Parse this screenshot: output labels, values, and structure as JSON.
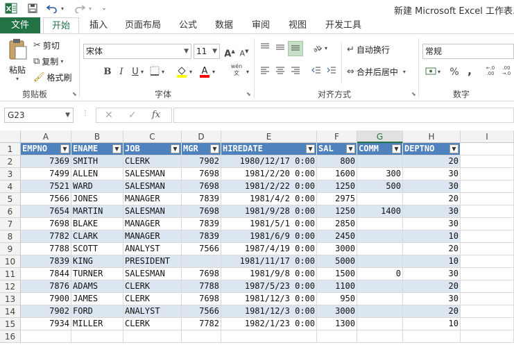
{
  "titlebar": {
    "title": "新建 Microsoft Excel 工作表.xlsx"
  },
  "tabs": [
    "文件",
    "开始",
    "插入",
    "页面布局",
    "公式",
    "数据",
    "审阅",
    "视图",
    "开发工具"
  ],
  "ribbon": {
    "clipboard": {
      "paste": "粘贴",
      "cut": "剪切",
      "copy": "复制",
      "format_painter": "格式刷",
      "label": "剪贴板"
    },
    "font": {
      "name": "宋体",
      "size": "11",
      "bold": "B",
      "italic": "I",
      "underline": "U",
      "label": "字体",
      "phonetic": "wén"
    },
    "alignment": {
      "wrap": "自动换行",
      "merge": "合并后居中",
      "label": "对齐方式"
    },
    "number": {
      "format": "常规",
      "label": "数字",
      "percent": "%",
      "comma": ","
    }
  },
  "formula_bar": {
    "name_box": "G23",
    "formula": ""
  },
  "columns": [
    "A",
    "B",
    "C",
    "D",
    "E",
    "F",
    "G",
    "H",
    "I"
  ],
  "selected_column": "G",
  "header": [
    "EMPNO",
    "ENAME",
    "JOB",
    "MGR",
    "HIREDATE",
    "SAL",
    "COMM",
    "DEPTNO"
  ],
  "rows": [
    [
      "7369",
      "SMITH",
      "CLERK",
      "7902",
      "1980/12/17  0:00",
      "800",
      "",
      "20"
    ],
    [
      "7499",
      "ALLEN",
      "SALESMAN",
      "7698",
      "1981/2/20  0:00",
      "1600",
      "300",
      "30"
    ],
    [
      "7521",
      "WARD",
      "SALESMAN",
      "7698",
      "1981/2/22  0:00",
      "1250",
      "500",
      "30"
    ],
    [
      "7566",
      "JONES",
      "MANAGER",
      "7839",
      "1981/4/2  0:00",
      "2975",
      "",
      "20"
    ],
    [
      "7654",
      "MARTIN",
      "SALESMAN",
      "7698",
      "1981/9/28  0:00",
      "1250",
      "1400",
      "30"
    ],
    [
      "7698",
      "BLAKE",
      "MANAGER",
      "7839",
      "1981/5/1  0:00",
      "2850",
      "",
      "30"
    ],
    [
      "7782",
      "CLARK",
      "MANAGER",
      "7839",
      "1981/6/9  0:00",
      "2450",
      "",
      "10"
    ],
    [
      "7788",
      "SCOTT",
      "ANALYST",
      "7566",
      "1987/4/19  0:00",
      "3000",
      "",
      "20"
    ],
    [
      "7839",
      "KING",
      "PRESIDENT",
      "",
      "1981/11/17  0:00",
      "5000",
      "",
      "10"
    ],
    [
      "7844",
      "TURNER",
      "SALESMAN",
      "7698",
      "1981/9/8  0:00",
      "1500",
      "0",
      "30"
    ],
    [
      "7876",
      "ADAMS",
      "CLERK",
      "7788",
      "1987/5/23  0:00",
      "1100",
      "",
      "20"
    ],
    [
      "7900",
      "JAMES",
      "CLERK",
      "7698",
      "1981/12/3  0:00",
      "950",
      "",
      "30"
    ],
    [
      "7902",
      "FORD",
      "ANALYST",
      "7566",
      "1981/12/3  0:00",
      "3000",
      "",
      "20"
    ],
    [
      "7934",
      "MILLER",
      "CLERK",
      "7782",
      "1982/1/23  0:00",
      "1300",
      "",
      "10"
    ]
  ],
  "row_numbers": [
    "1",
    "2",
    "3",
    "4",
    "5",
    "6",
    "7",
    "8",
    "9",
    "10",
    "11",
    "12",
    "13",
    "14",
    "15",
    "16"
  ],
  "colors": {
    "excel_green": "#217346",
    "table_header": "#4f81bd",
    "band": "#dce6f1"
  }
}
